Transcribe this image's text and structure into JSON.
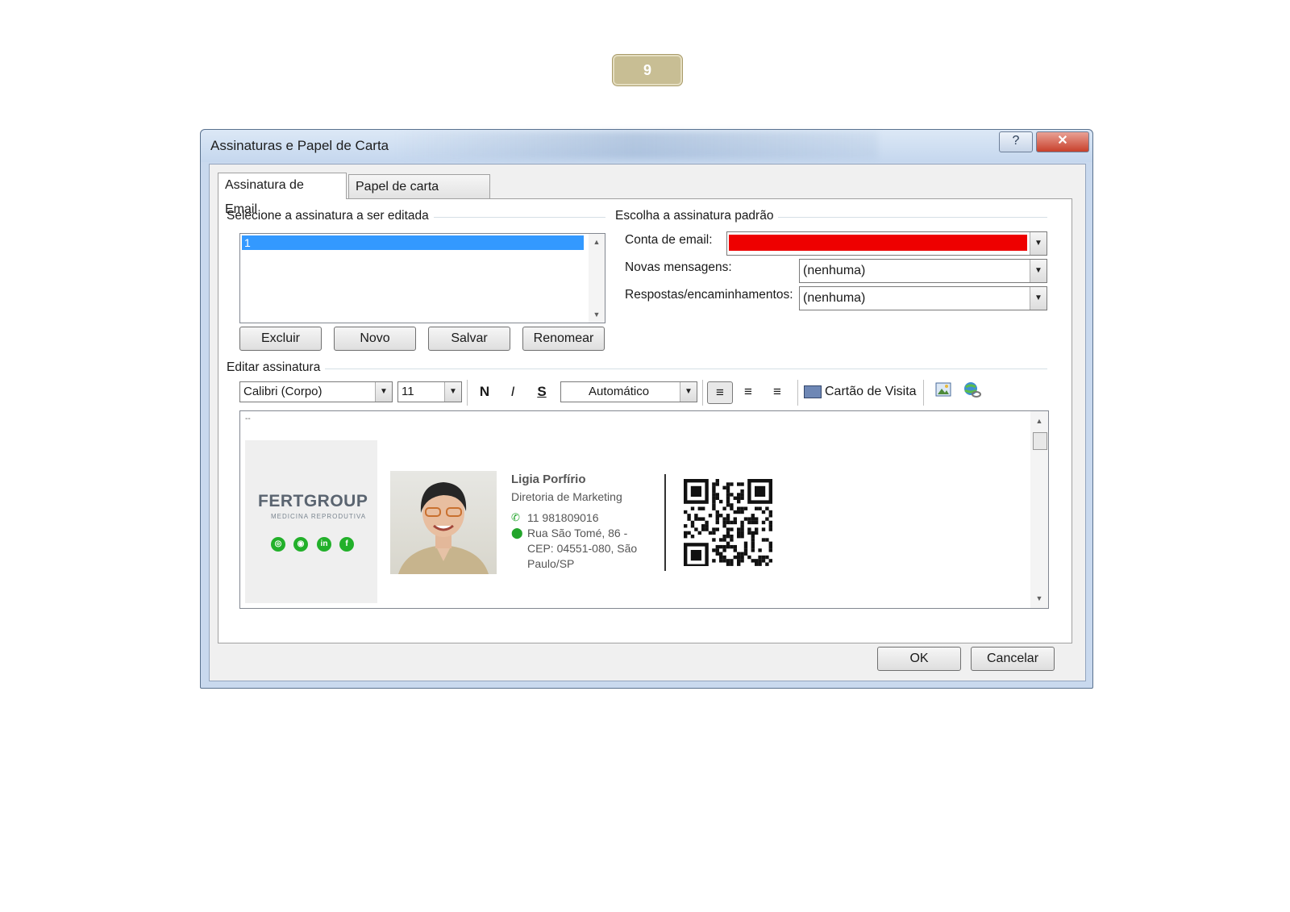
{
  "page_number": "9",
  "dialog": {
    "title": "Assinaturas e Papel de Carta",
    "help_label": "?",
    "close_label": "✕"
  },
  "tabs": [
    {
      "label": "Assinatura de Email",
      "active": true
    },
    {
      "label": "Papel de carta pessoal",
      "active": false
    }
  ],
  "select_signature": {
    "group_label": "Selecione a assinatura a ser editada",
    "items": [
      "1"
    ],
    "selected_index": 0
  },
  "buttons": {
    "delete": "Excluir",
    "new": "Novo",
    "save": "Salvar",
    "rename": "Renomear",
    "ok": "OK",
    "cancel": "Cancelar"
  },
  "default_signature": {
    "group_label": "Escolha a assinatura padrão",
    "email_account_label": "Conta de email:",
    "email_account_value": "",
    "new_messages_label": "Novas mensagens:",
    "new_messages_value": "(nenhuma)",
    "replies_label": "Respostas/encaminhamentos:",
    "replies_value": "(nenhuma)"
  },
  "edit_signature": {
    "group_label": "Editar assinatura",
    "font": "Calibri (Corpo)",
    "size": "11",
    "bold_label": "N",
    "italic_label": "I",
    "strike_label": "S",
    "color": "Automático",
    "business_card_label": "Cartão de Visita"
  },
  "signature": {
    "marker": "--",
    "logo": "FERTGROUP",
    "logo_tagline": "MEDICINA REPRODUTIVA",
    "name": "Ligia Porfírio",
    "role": "Diretoria de Marketing",
    "phone": "11 981809016",
    "address_line1": "Rua São Tomé, 86 -",
    "address_line2": "CEP: 04551-080, São",
    "address_line3": "Paulo/SP",
    "social_icons": [
      "globe-icon",
      "instagram-icon",
      "linkedin-icon",
      "facebook-icon"
    ]
  },
  "colors": {
    "selection": "#3399ff",
    "redacted": "#ee0000",
    "brand_green": "#22b02a",
    "page_badge": "#c8be94"
  }
}
